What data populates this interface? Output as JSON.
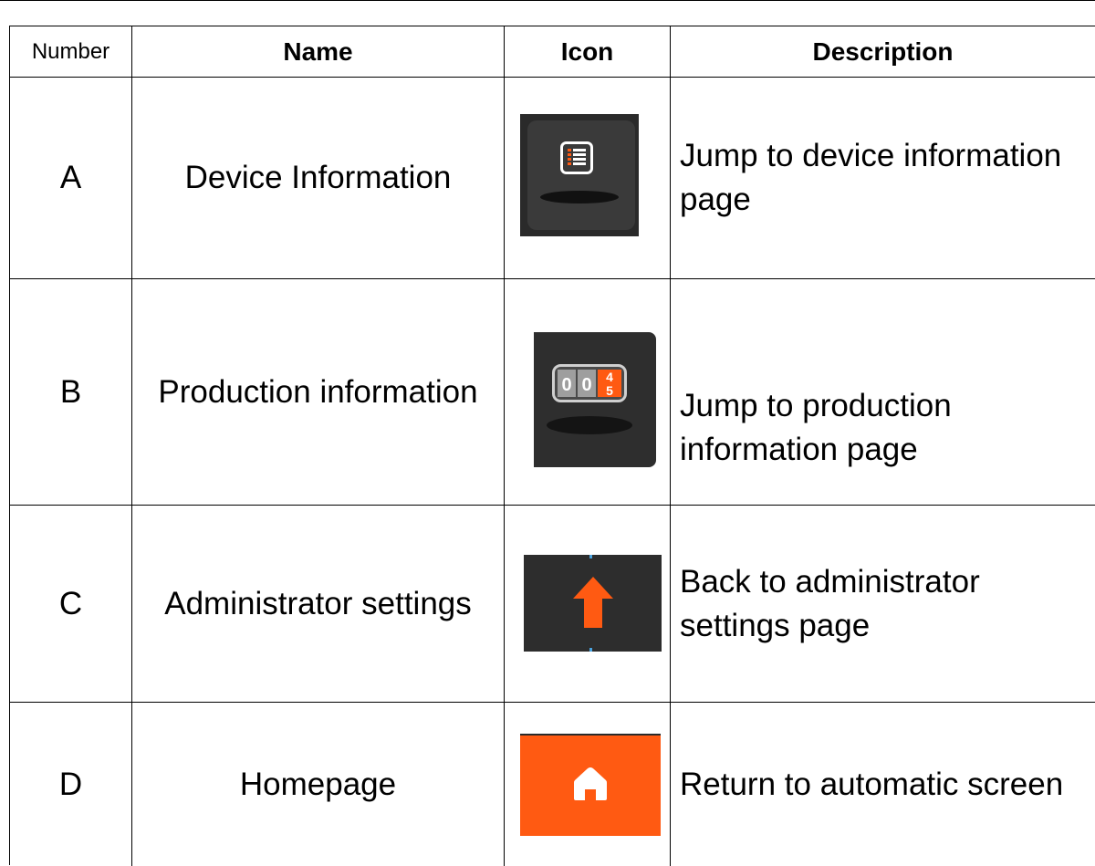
{
  "table": {
    "headers": {
      "number": "Number",
      "name": "Name",
      "icon": "Icon",
      "description": "Description"
    },
    "rows": [
      {
        "number": "A",
        "name": "Device Information",
        "icon": "device-info-list-icon",
        "description": "Jump to device information page"
      },
      {
        "number": "B",
        "name": "Production information",
        "icon": "production-counter-icon",
        "description": "Jump to production information page"
      },
      {
        "number": "C",
        "name": "Administrator settings",
        "icon": "up-arrow-icon",
        "description": "Back to administrator settings page"
      },
      {
        "number": "D",
        "name": "Homepage",
        "icon": "home-icon",
        "description": "Return to automatic screen"
      }
    ],
    "counter_digits": [
      "0",
      "0",
      "4",
      "5"
    ]
  },
  "colors": {
    "accent": "#ff5a12",
    "icon_bg": "#2d2d2d",
    "border": "#000000"
  }
}
